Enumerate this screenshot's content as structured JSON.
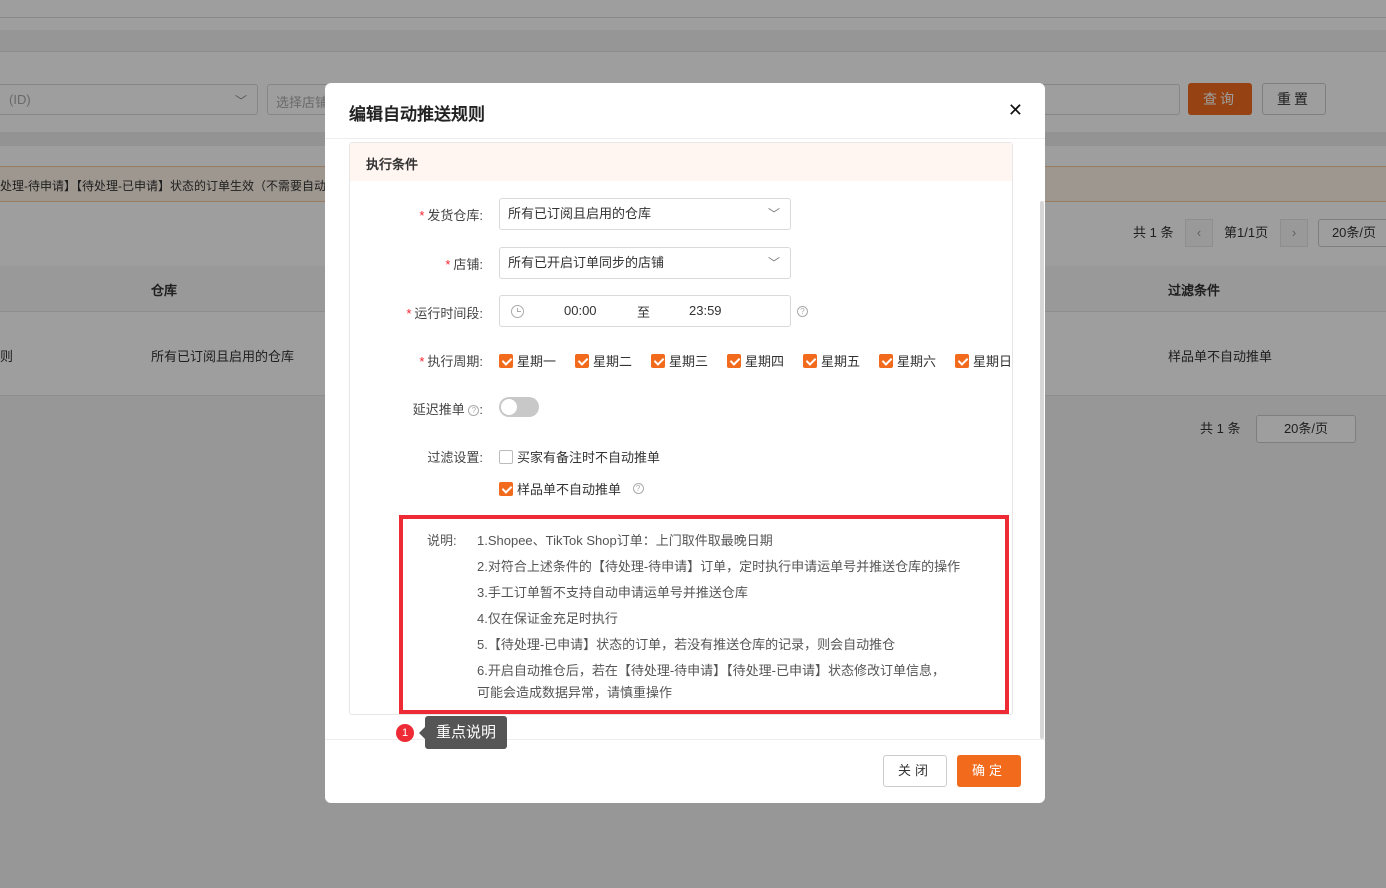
{
  "background": {
    "filter_select_value": "(ID)",
    "store_input_placeholder": "选择店铺",
    "search_button": "查询",
    "reset_button": "重置",
    "notice_text": "处理-待申请】【待处理-已申请】状态的订单生效（不需要自动",
    "pager_top": {
      "total": "共 1 条",
      "page": "第1/1页",
      "page_size": "20条/页"
    },
    "table_headers": {
      "warehouse": "仓库",
      "filter": "过滤条件"
    },
    "table_row": {
      "rule_fragment": "则",
      "warehouse": "所有已订阅且启用的仓库",
      "filter": "样品单不自动推单"
    },
    "pager_bottom": {
      "total": "共 1 条",
      "page_size": "20条/页"
    }
  },
  "modal": {
    "title": "编辑自动推送规则",
    "section_title": "执行条件",
    "fields": {
      "warehouse": {
        "label": "发货仓库:",
        "value": "所有已订阅且启用的仓库"
      },
      "store": {
        "label": "店铺:",
        "value": "所有已开启订单同步的店铺"
      },
      "time": {
        "label": "运行时间段:",
        "start": "00:00",
        "to": "至",
        "end": "23:59"
      },
      "cycle": {
        "label": "执行周期:",
        "days": [
          "星期一",
          "星期二",
          "星期三",
          "星期四",
          "星期五",
          "星期六",
          "星期日"
        ]
      },
      "delay": {
        "label": "延迟推单",
        "colon": ":"
      },
      "filter": {
        "label": "过滤设置:",
        "option1": "买家有备注时不自动推单",
        "option2": "样品单不自动推单"
      }
    },
    "notes": {
      "label": "说明:",
      "lines": [
        "1.Shopee、TikTok Shop订单：上门取件取最晚日期",
        "2.对符合上述条件的【待处理-待申请】订单，定时执行申请运单号并推送仓库的操作",
        "3.手工订单暂不支持自动申请运单号并推送仓库",
        "4.仅在保证金充足时执行",
        "5.【待处理-已申请】状态的订单，若没有推送仓库的记录，则会自动推仓",
        "6.开启自动推仓后，若在【待处理-待申请】【待处理-已申请】状态修改订单信息，",
        "可能会造成数据异常，请慎重操作"
      ]
    },
    "buttons": {
      "close": "关闭",
      "ok": "确定"
    }
  },
  "annotation": {
    "number": "1",
    "tooltip": "重点说明"
  }
}
